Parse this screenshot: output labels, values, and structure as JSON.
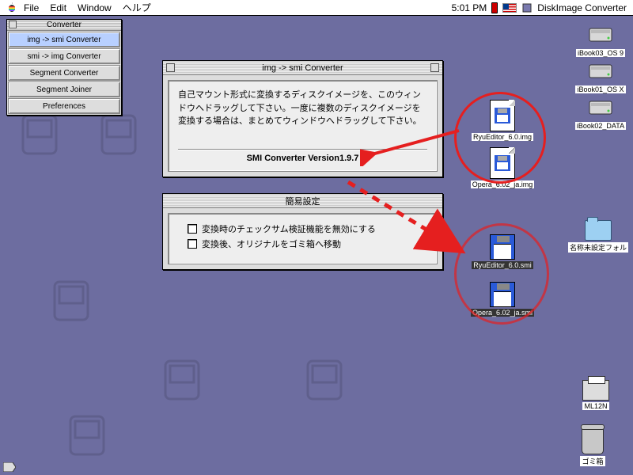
{
  "menubar": {
    "items": [
      "File",
      "Edit",
      "Window",
      "ヘルプ"
    ],
    "clock": "5:01 PM",
    "app_name": "DiskImage Converter"
  },
  "palette": {
    "title": "Converter",
    "buttons": [
      "img -> smi Converter",
      "smi -> img Converter",
      "Segment Converter",
      "Segment Joiner",
      "Preferences"
    ]
  },
  "converter_window": {
    "title": "img -> smi Converter",
    "instructions": "自己マウント形式に変換するディスクイメージを、このウィンドウへドラッグして下さい。一度に複数のディスクイメージを変換する場合は、まとめてウィンドウへドラッグして下さい。",
    "version_line": "SMI Converter Version1.9.7"
  },
  "settings_window": {
    "title": "簡易設定",
    "checkboxes": [
      "変換時のチェックサム検証機能を無効にする",
      "変換後、オリジナルをゴミ箱へ移動"
    ]
  },
  "desktop": {
    "drives": [
      {
        "label": "iBook03_OS 9"
      },
      {
        "label": "iBook01_OS X"
      },
      {
        "label": "iBook02_DATA"
      }
    ],
    "img_files": [
      {
        "label": "RyuEditor_6.0.img"
      },
      {
        "label": "Opera_6.02_ja.img"
      }
    ],
    "smi_files": [
      {
        "label": "RyuEditor_6.0.smi"
      },
      {
        "label": "Opera_6.02_ja.smi"
      }
    ],
    "folder": {
      "label": "名称未設定フォル"
    },
    "printer": {
      "label": "ML12N"
    },
    "trash": {
      "label": "ゴミ箱"
    }
  }
}
